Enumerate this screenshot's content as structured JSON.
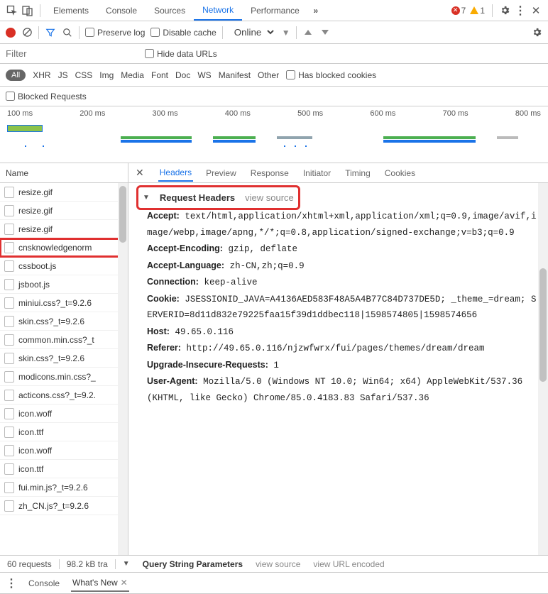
{
  "toolbar1": {
    "tabs": [
      "Elements",
      "Console",
      "Sources",
      "Network",
      "Performance"
    ],
    "active": "Network",
    "errors": 7,
    "warnings": 1
  },
  "toolbar2": {
    "preserve_log": "Preserve log",
    "disable_cache": "Disable cache",
    "throttle": "Online"
  },
  "filterbar": {
    "placeholder": "Filter",
    "hide_data_urls": "Hide data URLs"
  },
  "pillbar": {
    "all": "All",
    "items": [
      "XHR",
      "JS",
      "CSS",
      "Img",
      "Media",
      "Font",
      "Doc",
      "WS",
      "Manifest",
      "Other"
    ],
    "has_blocked": "Has blocked cookies"
  },
  "blocked": {
    "label": "Blocked Requests"
  },
  "timeline": {
    "labels": [
      "100 ms",
      "200 ms",
      "300 ms",
      "400 ms",
      "500 ms",
      "600 ms",
      "700 ms",
      "800 ms"
    ]
  },
  "sidebar": {
    "header": "Name",
    "rows": [
      "resize.gif",
      "resize.gif",
      "resize.gif",
      "cnsknowledgenorm",
      "cssboot.js",
      "jsboot.js",
      "miniui.css?_t=9.2.6",
      "skin.css?_t=9.2.6",
      "common.min.css?_t",
      "skin.css?_t=9.2.6",
      "modicons.min.css?_",
      "acticons.css?_t=9.2.",
      "icon.woff",
      "icon.ttf",
      "icon.woff",
      "icon.ttf",
      "fui.min.js?_t=9.2.6",
      "zh_CN.js?_t=9.2.6"
    ],
    "selected_index": 3
  },
  "details": {
    "tabs": [
      "Headers",
      "Preview",
      "Response",
      "Initiator",
      "Timing",
      "Cookies"
    ],
    "active": "Headers",
    "section": "Request Headers",
    "view_source": "view source",
    "headers": {
      "accept_k": "Accept:",
      "accept_v": "text/html,application/xhtml+xml,application/xml;q=0.9,image/avif,image/webp,image/apng,*/*;q=0.8,application/signed-exchange;v=b3;q=0.9",
      "accenc_k": "Accept-Encoding:",
      "accenc_v": "gzip, deflate",
      "acclang_k": "Accept-Language:",
      "acclang_v": "zh-CN,zh;q=0.9",
      "conn_k": "Connection:",
      "conn_v": "keep-alive",
      "cookie_k": "Cookie:",
      "cookie_v": "JSESSIONID_JAVA=A4136AED583F48A5A4B77C84D737DE5D; _theme_=dream; SERVERID=8d11d832e79225faa15f39d1ddbec118|1598574805|1598574656",
      "host_k": "Host:",
      "host_v": "49.65.0.116",
      "referer_k": "Referer:",
      "referer_v": "http://49.65.0.116/njzwfwrx/fui/pages/themes/dream/dream",
      "upgrade_k": "Upgrade-Insecure-Requests:",
      "upgrade_v": "1",
      "ua_k": "User-Agent:",
      "ua_v": "Mozilla/5.0 (Windows NT 10.0; Win64; x64) AppleWebKit/537.36 (KHTML, like Gecko) Chrome/85.0.4183.83 Safari/537.36"
    },
    "qsp": {
      "title": "Query String Parameters",
      "vs": "view source",
      "vue": "view URL encoded"
    }
  },
  "status": {
    "requests": "60 requests",
    "transfer": "98.2 kB tra"
  },
  "drawer": {
    "tabs": [
      "Console",
      "What's New"
    ],
    "active": "What's New"
  }
}
